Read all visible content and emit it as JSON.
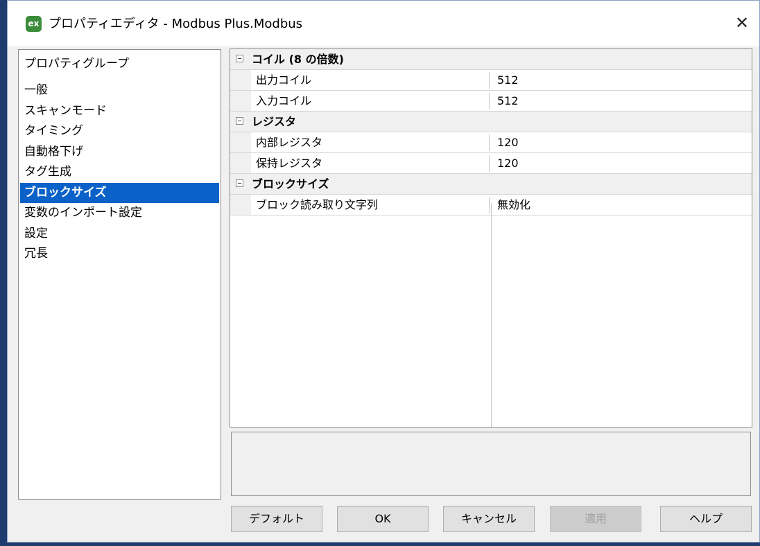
{
  "window": {
    "title": "プロパティエディタ - Modbus Plus.Modbus",
    "app_icon_text": "ex",
    "close_glyph": "✕"
  },
  "groups": {
    "header": "プロパティグループ",
    "items": [
      {
        "label": "一般"
      },
      {
        "label": "スキャンモード"
      },
      {
        "label": "タイミング"
      },
      {
        "label": "自動格下げ"
      },
      {
        "label": "タグ生成"
      },
      {
        "label": "ブロックサイズ",
        "selected": true
      },
      {
        "label": "変数のインポート設定"
      },
      {
        "label": "設定"
      },
      {
        "label": "冗長"
      }
    ]
  },
  "property_grid": {
    "categories": [
      {
        "label": "コイル (8 の倍数)",
        "properties": [
          {
            "name": "出力コイル",
            "value": "512"
          },
          {
            "name": "入力コイル",
            "value": "512"
          }
        ]
      },
      {
        "label": "レジスタ",
        "properties": [
          {
            "name": "内部レジスタ",
            "value": "120"
          },
          {
            "name": "保持レジスタ",
            "value": "120"
          }
        ]
      },
      {
        "label": "ブロックサイズ",
        "properties": [
          {
            "name": "ブロック読み取り文字列",
            "value": "無効化"
          }
        ]
      }
    ]
  },
  "buttons": {
    "default": "デフォルト",
    "ok": "OK",
    "cancel": "キャンセル",
    "apply": "適用",
    "help": "ヘルプ"
  },
  "colors": {
    "selection": "#0a62c8",
    "background": "#1e3c6e"
  }
}
